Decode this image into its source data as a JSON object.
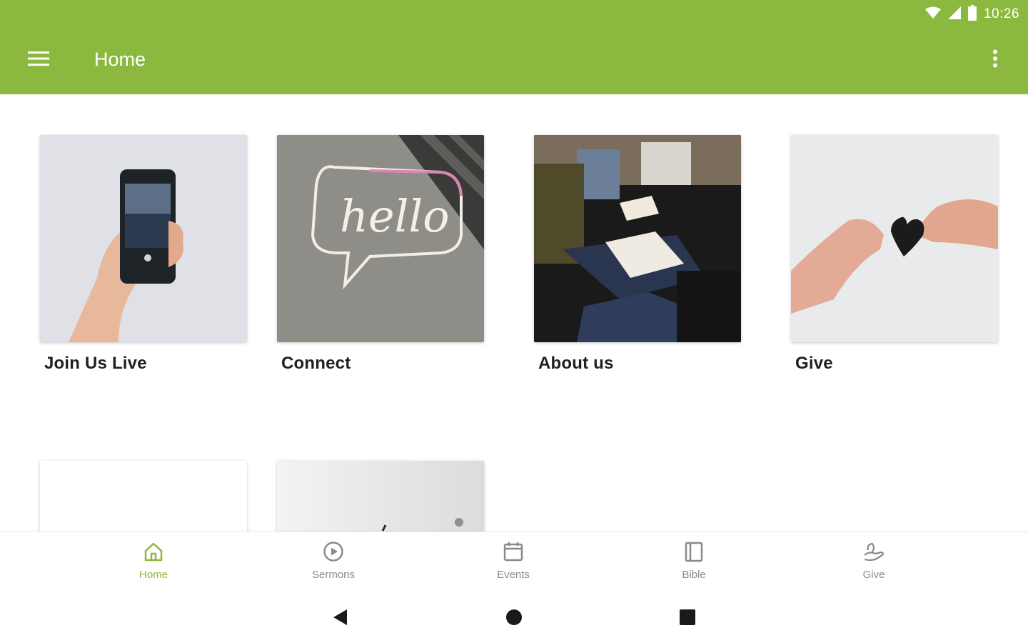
{
  "status_bar": {
    "time": "10:26"
  },
  "app_bar": {
    "title": "Home"
  },
  "cards": [
    {
      "label": "Join Us Live"
    },
    {
      "label": "Connect"
    },
    {
      "label": "About us"
    },
    {
      "label": "Give"
    }
  ],
  "bottom_nav": {
    "items": [
      {
        "label": "Home",
        "icon": "home-icon",
        "active": true
      },
      {
        "label": "Sermons",
        "icon": "play-circle-icon",
        "active": false
      },
      {
        "label": "Events",
        "icon": "calendar-icon",
        "active": false
      },
      {
        "label": "Bible",
        "icon": "book-icon",
        "active": false
      },
      {
        "label": "Give",
        "icon": "give-hand-icon",
        "active": false
      }
    ]
  },
  "colors": {
    "primary": "#8bb83e",
    "inactive": "#8a8a8a"
  }
}
